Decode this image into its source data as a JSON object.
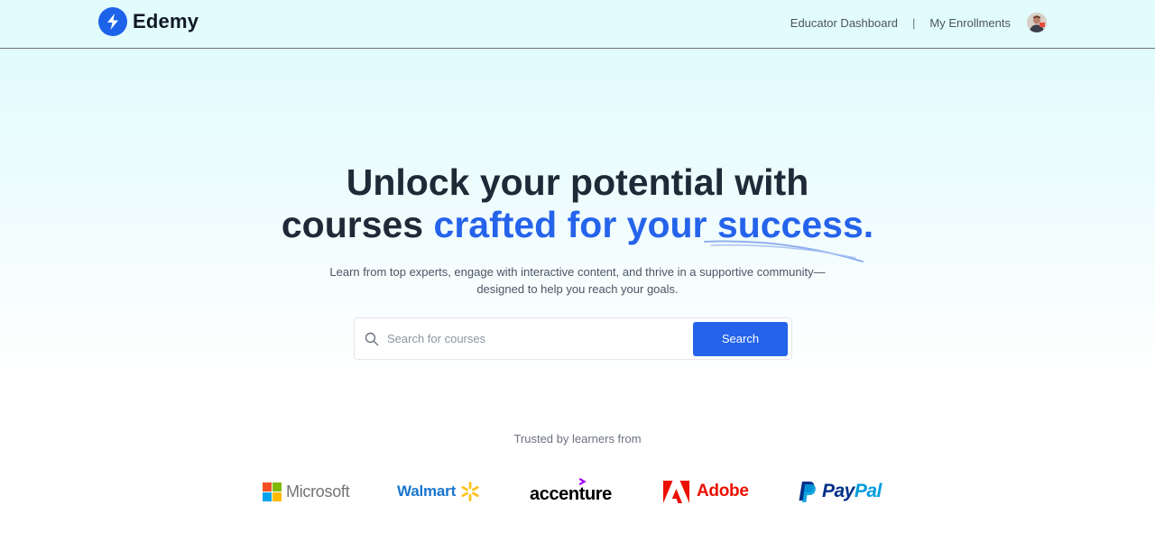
{
  "navbar": {
    "brand_name": "Edemy",
    "educator_dashboard": "Educator Dashboard",
    "separator": "|",
    "my_enrollments": "My Enrollments"
  },
  "hero": {
    "headline_line1": "Unlock your potential with",
    "headline_line2_prefix": "courses",
    "headline_line2_accent": "crafted for your success.",
    "subtitle_line1": "Learn from top experts, engage with interactive content, and thrive in a supportive community—",
    "subtitle_line2": "designed to help you reach your goals."
  },
  "search": {
    "placeholder": "Search for courses",
    "button_label": "Search"
  },
  "trusted": {
    "label": "Trusted by learners from",
    "companies": [
      {
        "name": "Microsoft",
        "icon": "microsoft-logo"
      },
      {
        "name": "Walmart",
        "icon": "walmart-spark-logo"
      },
      {
        "name": "accenture",
        "icon": "accenture-logo"
      },
      {
        "name": "Adobe",
        "icon": "adobe-logo"
      },
      {
        "name": "PayPal",
        "icon": "paypal-logo"
      }
    ]
  },
  "colors": {
    "accent": "#2563eb",
    "navbar_bg": "#e2fbfd",
    "headline": "#1f2937"
  }
}
